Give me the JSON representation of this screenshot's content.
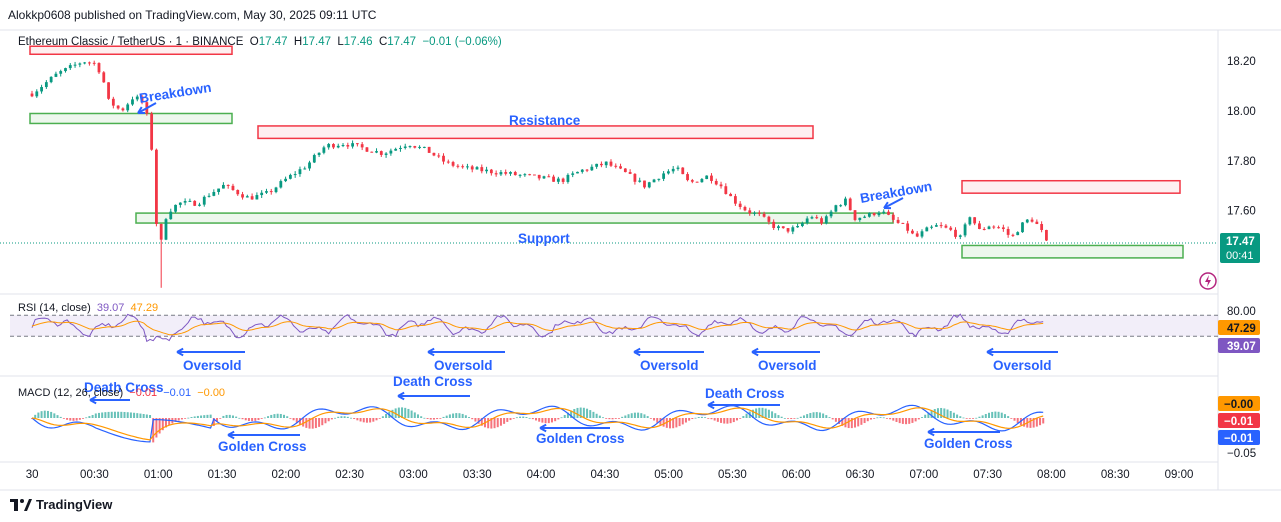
{
  "header": {
    "published": "Alokkp0608 published on TradingView.com, May 30, 2025 09:11 UTC"
  },
  "legend": {
    "symbol": "Ethereum Classic / TetherUS · 1 · BINANCE",
    "o_label": "O",
    "o": "17.47",
    "h_label": "H",
    "h": "17.47",
    "l_label": "L",
    "l": "17.46",
    "c_label": "C",
    "c": "17.47",
    "change": "−0.01 (−0.06%)"
  },
  "rsi_legend": {
    "label": "RSI (14, close)",
    "v1": "39.07",
    "v2": "47.29"
  },
  "macd_legend": {
    "label": "MACD (12, 26, close)",
    "v1": "−0.01",
    "v2": "−0.01",
    "v3": "−0.00"
  },
  "footer": {
    "brand": "TradingView"
  },
  "colors": {
    "up": "#089981",
    "down": "#f23645",
    "rsi": "#7e57c2",
    "signal": "#ff9800",
    "macd": "#2962ff",
    "annotation": "#2962ff"
  },
  "chart_data": [
    {
      "type": "candlestick",
      "title": "Ethereum Classic / TetherUS · 1 · BINANCE",
      "x_ticks": [
        "30",
        "00:30",
        "01:00",
        "01:30",
        "02:00",
        "02:30",
        "03:00",
        "03:30",
        "04:00",
        "04:30",
        "05:00",
        "05:30",
        "06:00",
        "06:30",
        "07:00",
        "07:30",
        "08:00",
        "08:30",
        "09:00"
      ],
      "y_ticks": [
        "18.20",
        "18.00",
        "17.80",
        "17.60"
      ],
      "ylim": [
        17.28,
        18.26
      ],
      "price_path": [
        [
          0.0,
          18.07
        ],
        [
          0.4,
          18.15
        ],
        [
          0.8,
          18.2
        ],
        [
          1.0,
          18.19
        ],
        [
          1.1,
          18.14
        ],
        [
          1.2,
          18.04
        ],
        [
          1.4,
          18.0
        ],
        [
          1.6,
          18.06
        ],
        [
          1.75,
          18.03
        ],
        [
          1.82,
          17.96
        ],
        [
          1.9,
          17.8
        ],
        [
          1.95,
          17.55
        ],
        [
          2.0,
          17.4
        ],
        [
          2.05,
          17.55
        ],
        [
          2.15,
          17.6
        ],
        [
          2.3,
          17.63
        ],
        [
          2.6,
          17.63
        ],
        [
          2.8,
          17.67
        ],
        [
          3.0,
          17.7
        ],
        [
          3.4,
          17.65
        ],
        [
          3.7,
          17.67
        ],
        [
          4.0,
          17.73
        ],
        [
          4.3,
          17.78
        ],
        [
          4.6,
          17.86
        ],
        [
          4.9,
          17.87
        ],
        [
          5.2,
          17.85
        ],
        [
          5.5,
          17.83
        ],
        [
          5.7,
          17.85
        ],
        [
          5.9,
          17.87
        ],
        [
          6.2,
          17.84
        ],
        [
          6.5,
          17.79
        ],
        [
          6.8,
          17.77
        ],
        [
          7.1,
          17.76
        ],
        [
          7.4,
          17.75
        ],
        [
          7.7,
          17.74
        ],
        [
          8.0,
          17.73
        ],
        [
          8.3,
          17.72
        ],
        [
          8.6,
          17.76
        ],
        [
          9.0,
          17.79
        ],
        [
          9.3,
          17.75
        ],
        [
          9.6,
          17.7
        ],
        [
          9.9,
          17.75
        ],
        [
          10.1,
          17.77
        ],
        [
          10.3,
          17.71
        ],
        [
          10.6,
          17.74
        ],
        [
          10.8,
          17.7
        ],
        [
          11.0,
          17.64
        ],
        [
          11.2,
          17.6
        ],
        [
          11.4,
          17.58
        ],
        [
          11.6,
          17.54
        ],
        [
          11.8,
          17.52
        ],
        [
          12.0,
          17.53
        ],
        [
          12.2,
          17.58
        ],
        [
          12.4,
          17.55
        ],
        [
          12.6,
          17.62
        ],
        [
          12.75,
          17.64
        ],
        [
          12.9,
          17.57
        ],
        [
          13.1,
          17.58
        ],
        [
          13.3,
          17.6
        ],
        [
          13.5,
          17.56
        ],
        [
          13.7,
          17.53
        ],
        [
          13.85,
          17.49
        ],
        [
          14.0,
          17.52
        ],
        [
          14.2,
          17.54
        ],
        [
          14.4,
          17.52
        ],
        [
          14.55,
          17.49
        ],
        [
          14.7,
          17.58
        ],
        [
          14.85,
          17.52
        ],
        [
          15.0,
          17.54
        ],
        [
          15.2,
          17.53
        ],
        [
          15.35,
          17.49
        ],
        [
          15.5,
          17.54
        ],
        [
          15.65,
          17.57
        ],
        [
          15.8,
          17.53
        ],
        [
          15.9,
          17.47
        ]
      ],
      "horizontal_line": 17.47,
      "zones": [
        {
          "kind": "resistance",
          "y_top": 18.26,
          "y_bottom": 18.24
        },
        {
          "kind": "support",
          "y_top": 17.99,
          "y_bottom": 17.95
        },
        {
          "kind": "resistance",
          "y_top": 17.94,
          "y_bottom": 17.89
        },
        {
          "kind": "support",
          "y_top": 17.59,
          "y_bottom": 17.55
        },
        {
          "kind": "resistance",
          "y_top": 17.72,
          "y_bottom": 17.67
        },
        {
          "kind": "support",
          "y_top": 17.46,
          "y_bottom": 17.41
        }
      ],
      "annotations": [
        "Breakdown",
        "Resistance",
        "Support",
        "Breakdown"
      ],
      "last_price": "17.47",
      "countdown": "00:41"
    },
    {
      "type": "line",
      "title": "RSI (14, close)",
      "y_ticks": [
        "80.00"
      ],
      "levels": [
        70,
        30
      ],
      "ylim": [
        15,
        95
      ],
      "series": [
        {
          "name": "RSI",
          "last": "39.07"
        },
        {
          "name": "RSI-based MA",
          "last": "47.29"
        }
      ],
      "annotations": [
        "Oversold",
        "Oversold",
        "Oversold",
        "Oversold",
        "Oversold"
      ]
    },
    {
      "type": "line",
      "title": "MACD (12, 26, close)",
      "y_ticks": [
        "−0.05"
      ],
      "series": [
        {
          "name": "MACD",
          "last": "−0.01"
        },
        {
          "name": "Signal",
          "last": "−0.01"
        },
        {
          "name": "Histogram",
          "last": "−0.00"
        }
      ],
      "annotations": [
        "Death Cross",
        "Golden Cross",
        "Death Cross",
        "Golden Cross",
        "Death Cross",
        "Golden Cross"
      ]
    }
  ]
}
